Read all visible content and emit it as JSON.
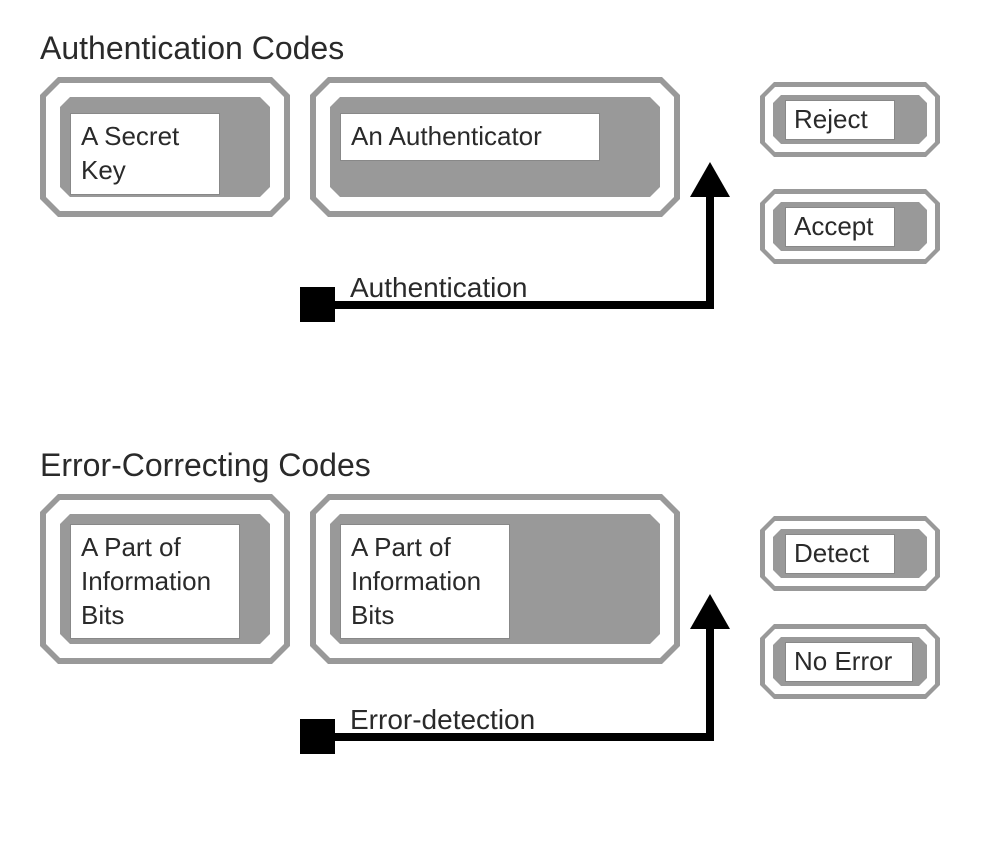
{
  "sections": [
    {
      "title": "Authentication Codes",
      "leftBox": "A Secret Key",
      "midBox": "An Authenticator",
      "processLabel": "Authentication",
      "outTop": "Reject",
      "outBottom": "Accept"
    },
    {
      "title": "Error-Correcting Codes",
      "leftBox": "A Part of Information Bits",
      "midBox": "A Part of Information Bits",
      "processLabel": "Error-detection",
      "outTop": "Detect",
      "outBottom": "No Error"
    }
  ]
}
